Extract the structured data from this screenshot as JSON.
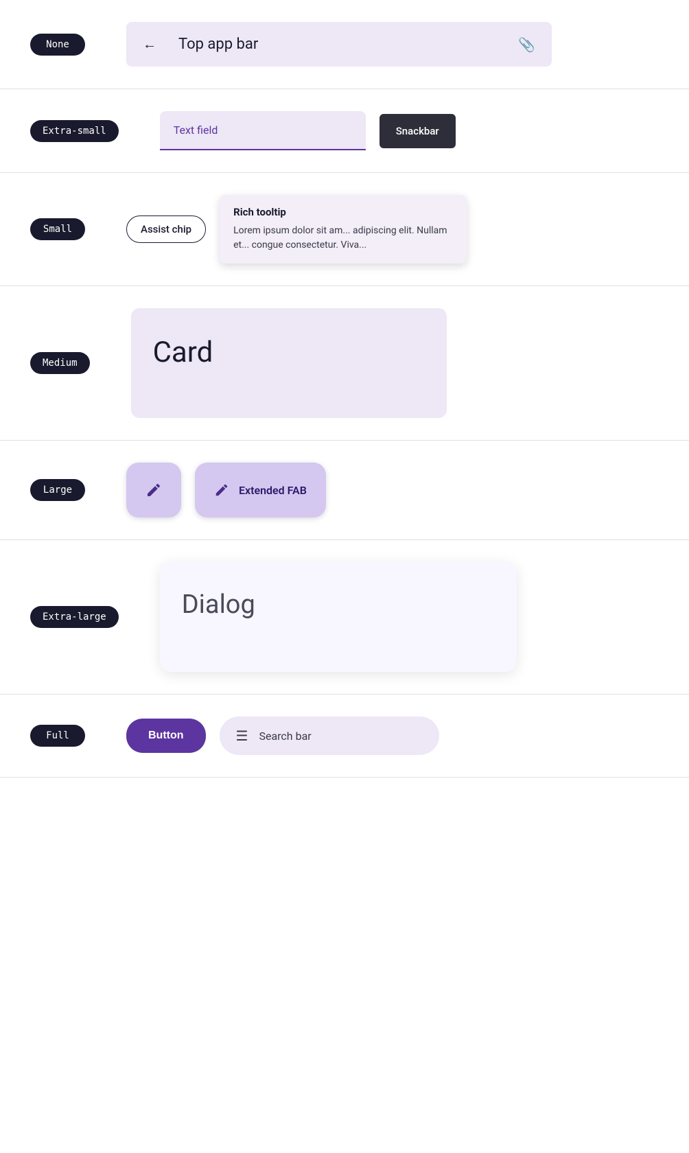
{
  "rows": [
    {
      "id": "none",
      "badge": "None",
      "content_type": "top_app_bar",
      "top_app_bar": {
        "title": "Top app bar",
        "back_icon": "←",
        "attachment_icon": "📎"
      }
    },
    {
      "id": "extra-small",
      "badge": "Extra-small",
      "content_type": "text_field_snackbar",
      "text_field": {
        "label": "Text field"
      },
      "snackbar": {
        "label": "Snackbar"
      }
    },
    {
      "id": "small",
      "badge": "Small",
      "content_type": "assist_chip_tooltip",
      "assist_chip": {
        "label": "Assist chip"
      },
      "rich_tooltip": {
        "title": "Rich tooltip",
        "body": "Lorem ipsum dolor sit am... adipiscing elit. Nullam et... congue consectetur. Viva..."
      }
    },
    {
      "id": "medium",
      "badge": "Medium",
      "content_type": "card",
      "card": {
        "title": "Card"
      }
    },
    {
      "id": "large",
      "badge": "Large",
      "content_type": "fab",
      "fab": {
        "icon": "✏"
      },
      "extended_fab": {
        "icon": "✏",
        "label": "Extended FAB"
      }
    },
    {
      "id": "extra-large",
      "badge": "Extra-large",
      "content_type": "dialog",
      "dialog": {
        "title": "Dialog"
      }
    },
    {
      "id": "full",
      "badge": "Full",
      "content_type": "button_searchbar",
      "button": {
        "label": "Button"
      },
      "search_bar": {
        "icon": "☰",
        "label": "Search bar"
      }
    }
  ]
}
